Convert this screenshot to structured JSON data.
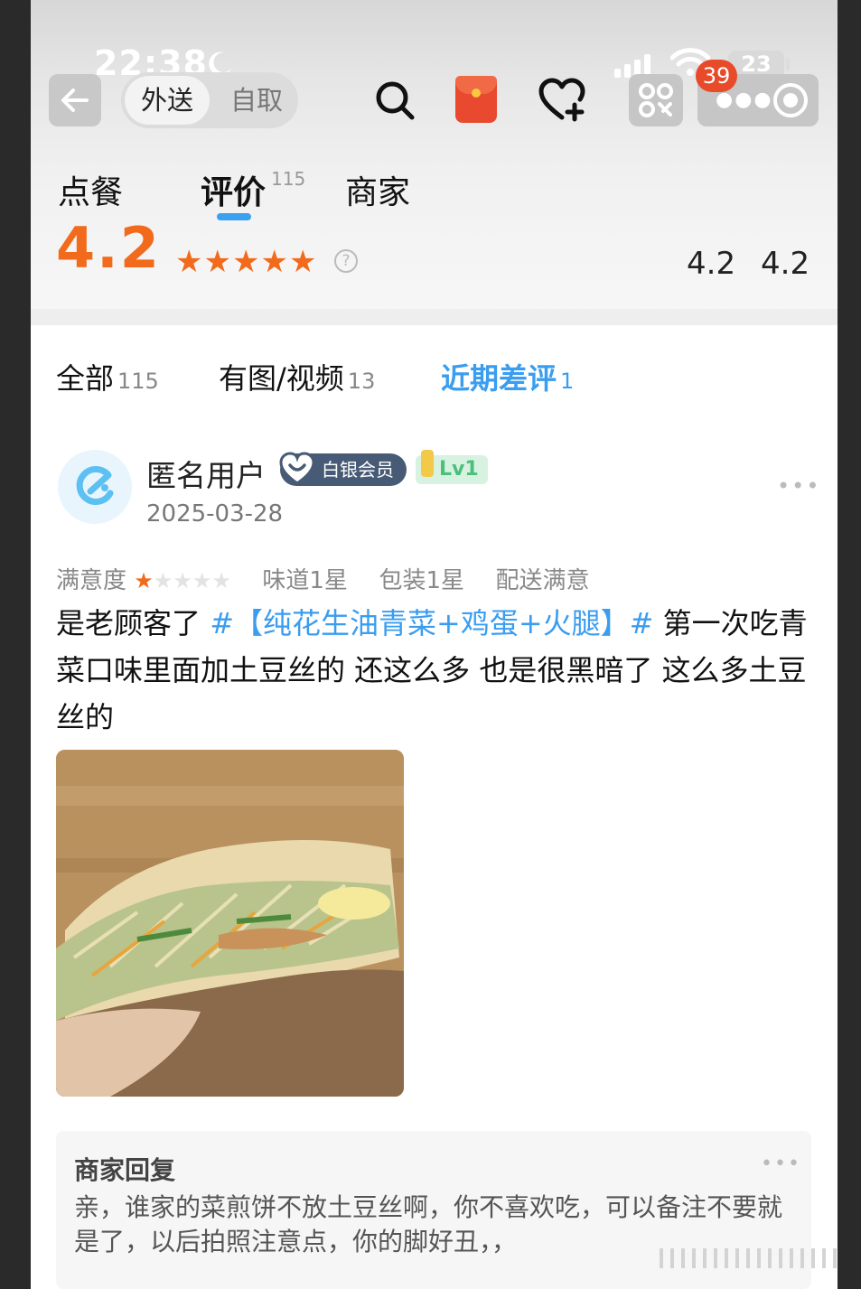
{
  "status_bar": {
    "time": "22:38",
    "battery": "23",
    "notification_count": "39"
  },
  "nav": {
    "mode_active": "外送",
    "mode_inactive": "自取"
  },
  "tabs": {
    "order": "点餐",
    "review": "评价",
    "review_count": "115",
    "merchant": "商家"
  },
  "score": {
    "overall": "4.2",
    "star_count": 5,
    "sub_score_1": "4.2",
    "sub_score_2": "4.2"
  },
  "filters": {
    "all_label": "全部",
    "all_count": "115",
    "media_label": "有图/视频",
    "media_count": "13",
    "bad_label": "近期差评",
    "bad_count": "1"
  },
  "review": {
    "user_name": "匿名用户",
    "member_badge": "白银会员",
    "level": "Lv1",
    "date": "2025-03-28",
    "satisfaction_label": "满意度",
    "satisfaction_stars": 1,
    "taste": "味道1星",
    "packaging": "包装1星",
    "delivery": "配送满意",
    "text_part1": "是老顾客了 ",
    "tag": "#【纯花生油青菜+鸡蛋+火腿】#",
    "text_part2": " 第一次吃青菜口味里面加土豆丝的 还这么多 也是很黑暗了 这么多土豆丝的"
  },
  "reply": {
    "title": "商家回复",
    "text": "亲，谁家的菜煎饼不放土豆丝啊，你不喜欢吃，可以备注不要就是了，以后拍照注意点，你的脚好丑，，"
  },
  "colors": {
    "accent_orange": "#f26a1b",
    "accent_blue": "#3a9df0"
  }
}
